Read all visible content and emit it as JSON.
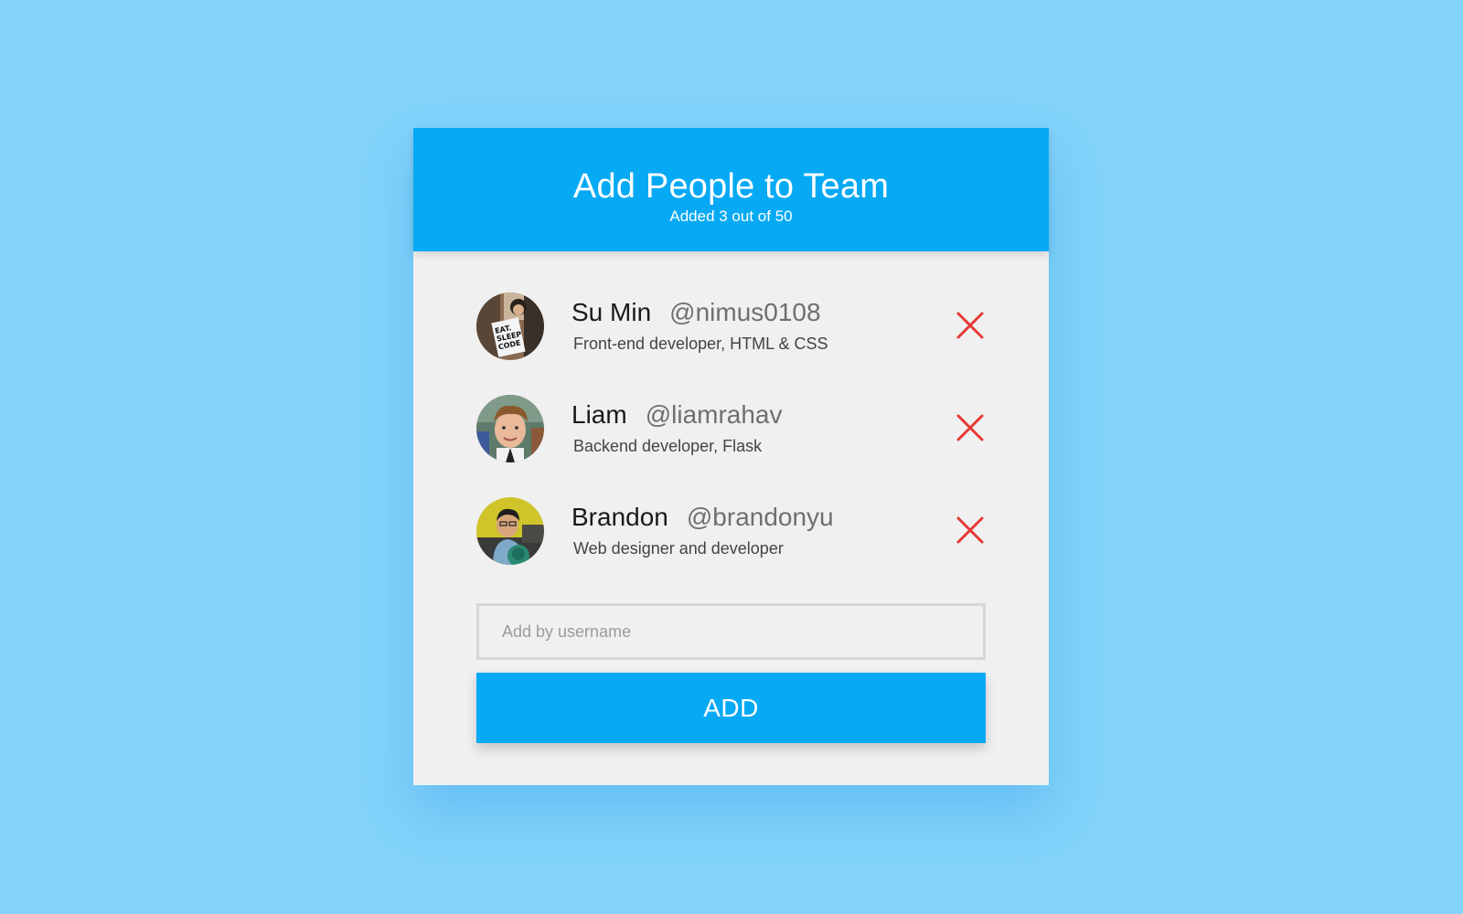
{
  "header": {
    "title": "Add People to Team",
    "subtitle": "Added 3 out of 50"
  },
  "members": [
    {
      "name": "Su Min",
      "handle": "@nimus0108",
      "role": "Front-end developer, HTML & CSS",
      "avatar_icon": "avatar-photo"
    },
    {
      "name": "Liam",
      "handle": "@liamrahav",
      "role": "Backend developer, Flask",
      "avatar_icon": "avatar-photo"
    },
    {
      "name": "Brandon",
      "handle": "@brandonyu",
      "role": "Web designer and developer",
      "avatar_icon": "avatar-photo"
    }
  ],
  "remove_icon": "close-icon",
  "add_form": {
    "placeholder": "Add by username",
    "value": "",
    "button_label": "ADD"
  },
  "colors": {
    "background": "#83d3fa",
    "accent": "#06a9f4",
    "card": "#f0f0f0",
    "remove": "#e53935"
  }
}
